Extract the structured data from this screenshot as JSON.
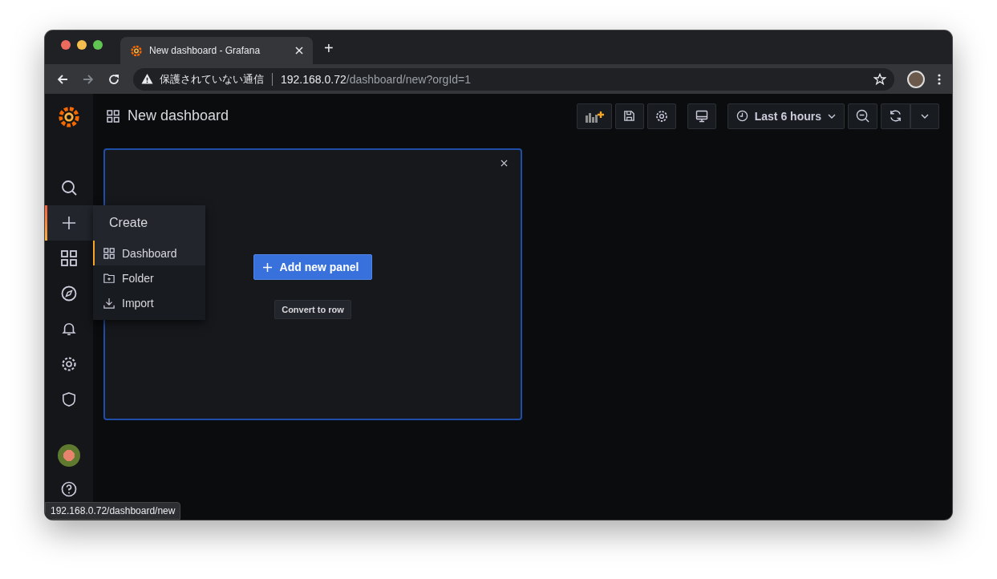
{
  "browser": {
    "tab": {
      "title": "New dashboard - Grafana",
      "selected": true
    },
    "new_tab": "+",
    "address": {
      "security_label": "保護されていない通信",
      "host": "192.168.0.72",
      "path": "/dashboard/new?orgId=1"
    },
    "status_url": "192.168.0.72/dashboard/new"
  },
  "sidebar": {
    "items": [
      {
        "kind": "search",
        "selected": false
      },
      {
        "kind": "create",
        "selected": true
      },
      {
        "kind": "dashboards",
        "selected": false
      },
      {
        "kind": "explore",
        "selected": false
      },
      {
        "kind": "alerting",
        "selected": false
      },
      {
        "kind": "configuration",
        "selected": false
      },
      {
        "kind": "server-admin",
        "selected": false
      }
    ],
    "bottom": [
      {
        "kind": "avatar",
        "selected": false
      },
      {
        "kind": "help",
        "selected": false
      }
    ]
  },
  "create_menu": {
    "title": "Create",
    "items": [
      {
        "kind": "dashboard",
        "label": "Dashboard",
        "selected": true
      },
      {
        "kind": "folder",
        "label": "Folder",
        "selected": false
      },
      {
        "kind": "import",
        "label": "Import",
        "selected": false
      }
    ]
  },
  "header": {
    "title": "New dashboard"
  },
  "toolbar": [
    {
      "kind": "add-panel"
    },
    {
      "kind": "save"
    },
    {
      "kind": "settings"
    },
    {
      "kind": "tv"
    },
    {
      "kind": "time-picker",
      "label": "Last 6 hours"
    },
    {
      "kind": "zoom-out"
    },
    {
      "kind": "refresh"
    },
    {
      "kind": "interval"
    }
  ],
  "panel": {
    "add_button": "Add new panel",
    "convert_button": "Convert to row"
  }
}
